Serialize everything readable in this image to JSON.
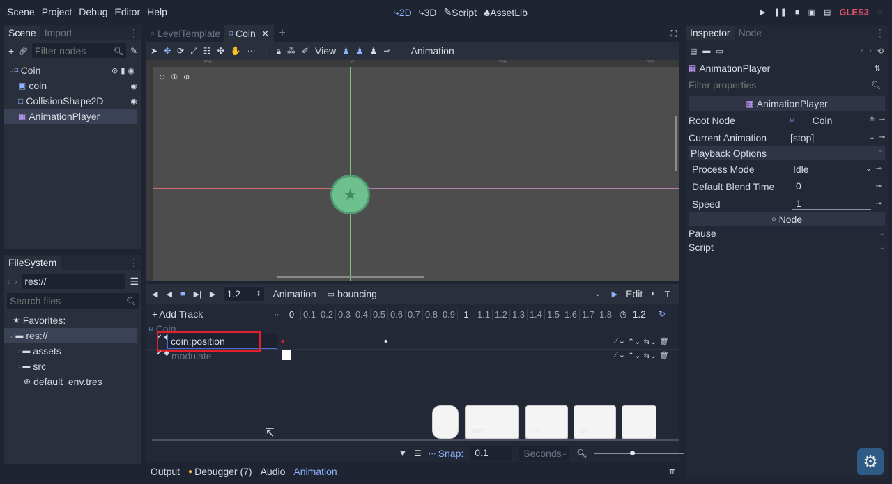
{
  "menu": [
    "Scene",
    "Project",
    "Debug",
    "Editor",
    "Help"
  ],
  "workspaces": [
    {
      "icon": "2d-icon",
      "label": "2D"
    },
    {
      "icon": "3d-icon",
      "label": "3D"
    },
    {
      "icon": "script-icon",
      "label": "Script"
    },
    {
      "icon": "assetlib-icon",
      "label": "AssetLib"
    }
  ],
  "renderer": "GLES3",
  "scene_dock": {
    "tabs": [
      "Scene",
      "Import"
    ],
    "filter_placeholder": "Filter nodes",
    "nodes": [
      {
        "label": "Coin",
        "depth": 0
      },
      {
        "label": "coin",
        "depth": 1
      },
      {
        "label": "CollisionShape2D",
        "depth": 1
      },
      {
        "label": "AnimationPlayer",
        "depth": 1,
        "selected": true
      }
    ]
  },
  "filesystem": {
    "tab": "FileSystem",
    "path": "res://",
    "search_placeholder": "Search files",
    "favorites": "Favorites:",
    "items": [
      "res://",
      "assets",
      "src",
      "default_env.tres"
    ]
  },
  "editor_tabs": [
    "LevelTemplate",
    "Coin"
  ],
  "toolbar2d": {
    "view": "View",
    "animation": "Animation"
  },
  "ruler": [
    "250",
    "0",
    "250",
    "500"
  ],
  "anim": {
    "time": "1.2",
    "animation_label": "Animation",
    "animation_name": "bouncing",
    "edit": "Edit",
    "add_track": "Add Track",
    "ticks": [
      "0",
      "0.1",
      "0.2",
      "0.3",
      "0.4",
      "0.5",
      "0.6",
      "0.7",
      "0.8",
      "0.9",
      "1",
      "1.1",
      "1.2",
      "1.3",
      "1.4",
      "1.5",
      "1.6",
      "1.7",
      "1.8"
    ],
    "length": "1.2",
    "node": "Coin",
    "tracks": [
      "coin:position",
      "modulate"
    ],
    "snap_label": "Snap:",
    "snap_value": "0.1",
    "snap_unit": "Seconds"
  },
  "keys": [
    "shift",
    "ctrl",
    "alt"
  ],
  "bottom_tabs": [
    "Output",
    "Debugger (7)",
    "Audio",
    "Animation"
  ],
  "inspector": {
    "tabs": [
      "Inspector",
      "Node"
    ],
    "node_name": "AnimationPlayer",
    "filter_placeholder": "Filter properties",
    "class_header": "AnimationPlayer",
    "root_node_label": "Root Node",
    "root_node_value": "Coin",
    "current_anim_label": "Current Animation",
    "current_anim_value": "[stop]",
    "playback_section": "Playback Options",
    "process_mode_label": "Process Mode",
    "process_mode_value": "Idle",
    "blend_label": "Default Blend Time",
    "blend_value": "0",
    "speed_label": "Speed",
    "speed_value": "1",
    "node_header": "Node",
    "pause": "Pause",
    "script": "Script"
  },
  "colors": {
    "accent": "#8fb4ff",
    "coin": "#6fc08f",
    "highlight": "#e2202b"
  }
}
